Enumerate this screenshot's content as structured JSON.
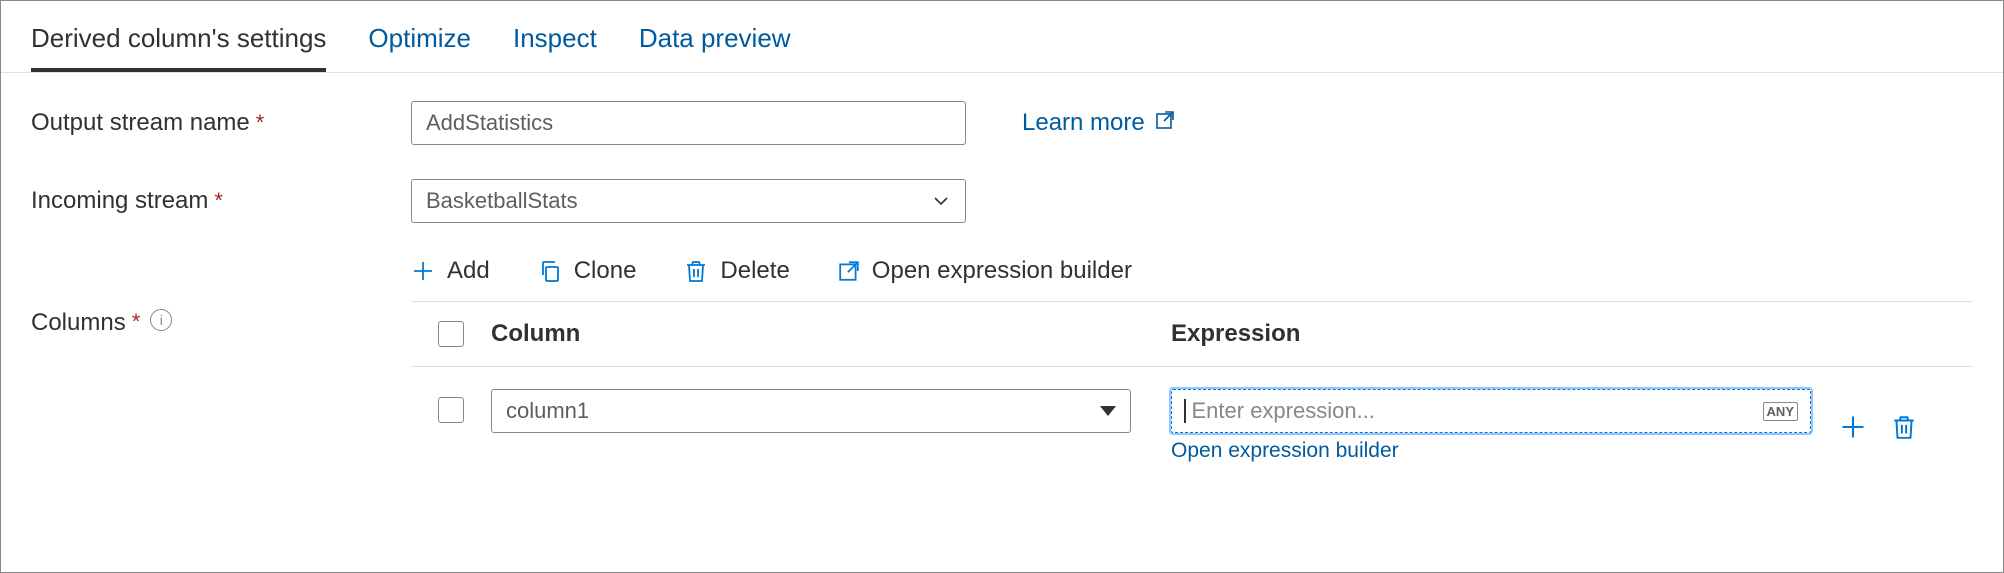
{
  "tabs": [
    {
      "label": "Derived column's settings",
      "active": true
    },
    {
      "label": "Optimize",
      "active": false
    },
    {
      "label": "Inspect",
      "active": false
    },
    {
      "label": "Data preview",
      "active": false
    }
  ],
  "form": {
    "output_stream_label": "Output stream name",
    "output_stream_value": "AddStatistics",
    "incoming_stream_label": "Incoming stream",
    "incoming_stream_value": "BasketballStats",
    "columns_label": "Columns",
    "learn_more_label": "Learn more"
  },
  "toolbar": {
    "add_label": "Add",
    "clone_label": "Clone",
    "delete_label": "Delete",
    "open_builder_label": "Open expression builder"
  },
  "table": {
    "headers": {
      "column": "Column",
      "expression": "Expression"
    },
    "rows": [
      {
        "column_value": "column1",
        "expression_value": "",
        "expression_placeholder": "Enter expression...",
        "any_tag": "ANY",
        "open_builder_link": "Open expression builder"
      }
    ]
  }
}
